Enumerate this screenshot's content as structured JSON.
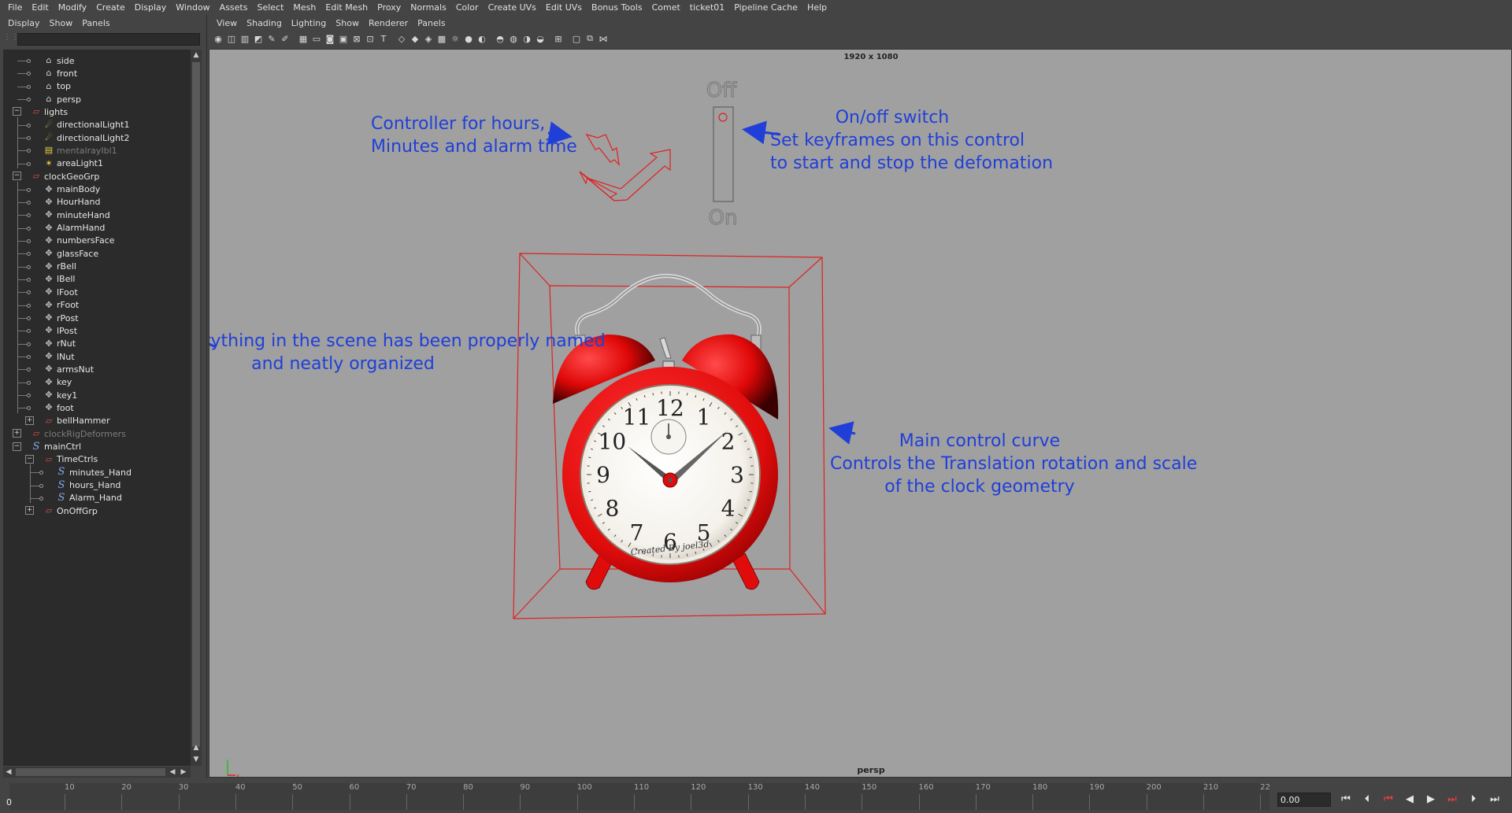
{
  "main_menu": [
    "File",
    "Edit",
    "Modify",
    "Create",
    "Display",
    "Window",
    "Assets",
    "Select",
    "Mesh",
    "Edit Mesh",
    "Proxy",
    "Normals",
    "Color",
    "Create UVs",
    "Edit UVs",
    "Bonus Tools",
    "Comet",
    "ticket01",
    "Pipeline Cache",
    "Help"
  ],
  "outliner": {
    "menu": [
      "Display",
      "Show",
      "Panels"
    ],
    "filter_value": "",
    "nodes": [
      {
        "label": "side",
        "icon": "camera-icon",
        "glyph": "⌂"
      },
      {
        "label": "front",
        "icon": "camera-icon",
        "glyph": "⌂"
      },
      {
        "label": "top",
        "icon": "camera-icon",
        "glyph": "⌂"
      },
      {
        "label": "persp",
        "icon": "camera-icon",
        "glyph": "⌂"
      },
      {
        "label": "lights",
        "icon": "group-icon",
        "glyph": "▱"
      },
      {
        "label": "directionalLight1",
        "icon": "light-icon",
        "glyph": "☄"
      },
      {
        "label": "directionalLight2",
        "icon": "light-icon",
        "glyph": "☄"
      },
      {
        "label": "mentalrayIbl1",
        "icon": "light-icon",
        "glyph": "▤"
      },
      {
        "label": "areaLight1",
        "icon": "light-icon",
        "glyph": "✶"
      },
      {
        "label": "clockGeoGrp",
        "icon": "group-icon",
        "glyph": "▱"
      },
      {
        "label": "mainBody",
        "icon": "mesh-icon",
        "glyph": "✥"
      },
      {
        "label": "HourHand",
        "icon": "mesh-icon",
        "glyph": "✥"
      },
      {
        "label": "minuteHand",
        "icon": "mesh-icon",
        "glyph": "✥"
      },
      {
        "label": "AlarmHand",
        "icon": "mesh-icon",
        "glyph": "✥"
      },
      {
        "label": "numbersFace",
        "icon": "mesh-icon",
        "glyph": "✥"
      },
      {
        "label": "glassFace",
        "icon": "mesh-icon",
        "glyph": "✥"
      },
      {
        "label": "rBell",
        "icon": "mesh-icon",
        "glyph": "✥"
      },
      {
        "label": "lBell",
        "icon": "mesh-icon",
        "glyph": "✥"
      },
      {
        "label": "lFoot",
        "icon": "mesh-icon",
        "glyph": "✥"
      },
      {
        "label": "rFoot",
        "icon": "mesh-icon",
        "glyph": "✥"
      },
      {
        "label": "rPost",
        "icon": "mesh-icon",
        "glyph": "✥"
      },
      {
        "label": "lPost",
        "icon": "mesh-icon",
        "glyph": "✥"
      },
      {
        "label": "rNut",
        "icon": "mesh-icon",
        "glyph": "✥"
      },
      {
        "label": "lNut",
        "icon": "mesh-icon",
        "glyph": "✥"
      },
      {
        "label": "armsNut",
        "icon": "mesh-icon",
        "glyph": "✥"
      },
      {
        "label": "key",
        "icon": "mesh-icon",
        "glyph": "✥"
      },
      {
        "label": "key1",
        "icon": "mesh-icon",
        "glyph": "✥"
      },
      {
        "label": "foot",
        "icon": "mesh-icon",
        "glyph": "✥"
      },
      {
        "label": "bellHammer",
        "icon": "group-icon",
        "glyph": "▱"
      },
      {
        "label": "clockRigDeformers",
        "icon": "group-icon",
        "glyph": "▱"
      },
      {
        "label": "mainCtrl",
        "icon": "curve-icon",
        "glyph": "S"
      },
      {
        "label": "TimeCtrls",
        "icon": "group-icon",
        "glyph": "▱"
      },
      {
        "label": "minutes_Hand",
        "icon": "curve-icon",
        "glyph": "S"
      },
      {
        "label": "hours_Hand",
        "icon": "curve-icon",
        "glyph": "S"
      },
      {
        "label": "Alarm_Hand",
        "icon": "curve-icon",
        "glyph": "S"
      },
      {
        "label": "OnOffGrp",
        "icon": "group-icon",
        "glyph": "▱"
      }
    ]
  },
  "viewport": {
    "menu": [
      "View",
      "Shading",
      "Lighting",
      "Show",
      "Renderer",
      "Panels"
    ],
    "resolution": "1920 x 1080",
    "camera": "persp",
    "switch_off_label": "Off",
    "switch_on_label": "On",
    "clock_signature": "Created By joel3d",
    "clock_numbers": [
      "12",
      "1",
      "2",
      "3",
      "4",
      "5",
      "6",
      "7",
      "8",
      "9",
      "10",
      "11"
    ],
    "annotations": {
      "controller": [
        "Controller for hours,",
        "Minutes and alarm time"
      ],
      "switch": [
        "On/off switch",
        "Set keyframes on this control",
        "to start and stop the defomation"
      ],
      "outliner": [
        "Everything in the scene has been properly named",
        "and neatly organized"
      ],
      "main_ctrl": [
        "Main control curve",
        "Controls the Translation rotation and scale",
        "of the clock geometry"
      ]
    },
    "colors": {
      "annotation": "#1f3fd8",
      "control_curve": "#e02020",
      "clock_red": "#e01010",
      "background": "#a0a0a0"
    }
  },
  "timeline": {
    "ticks": [
      "10",
      "20",
      "30",
      "40",
      "50",
      "60",
      "70",
      "80",
      "90",
      "100",
      "110",
      "120",
      "130",
      "140",
      "150",
      "160",
      "170",
      "180",
      "190",
      "200",
      "210",
      "22"
    ],
    "current_frame": "0",
    "time_value": "0.00"
  }
}
